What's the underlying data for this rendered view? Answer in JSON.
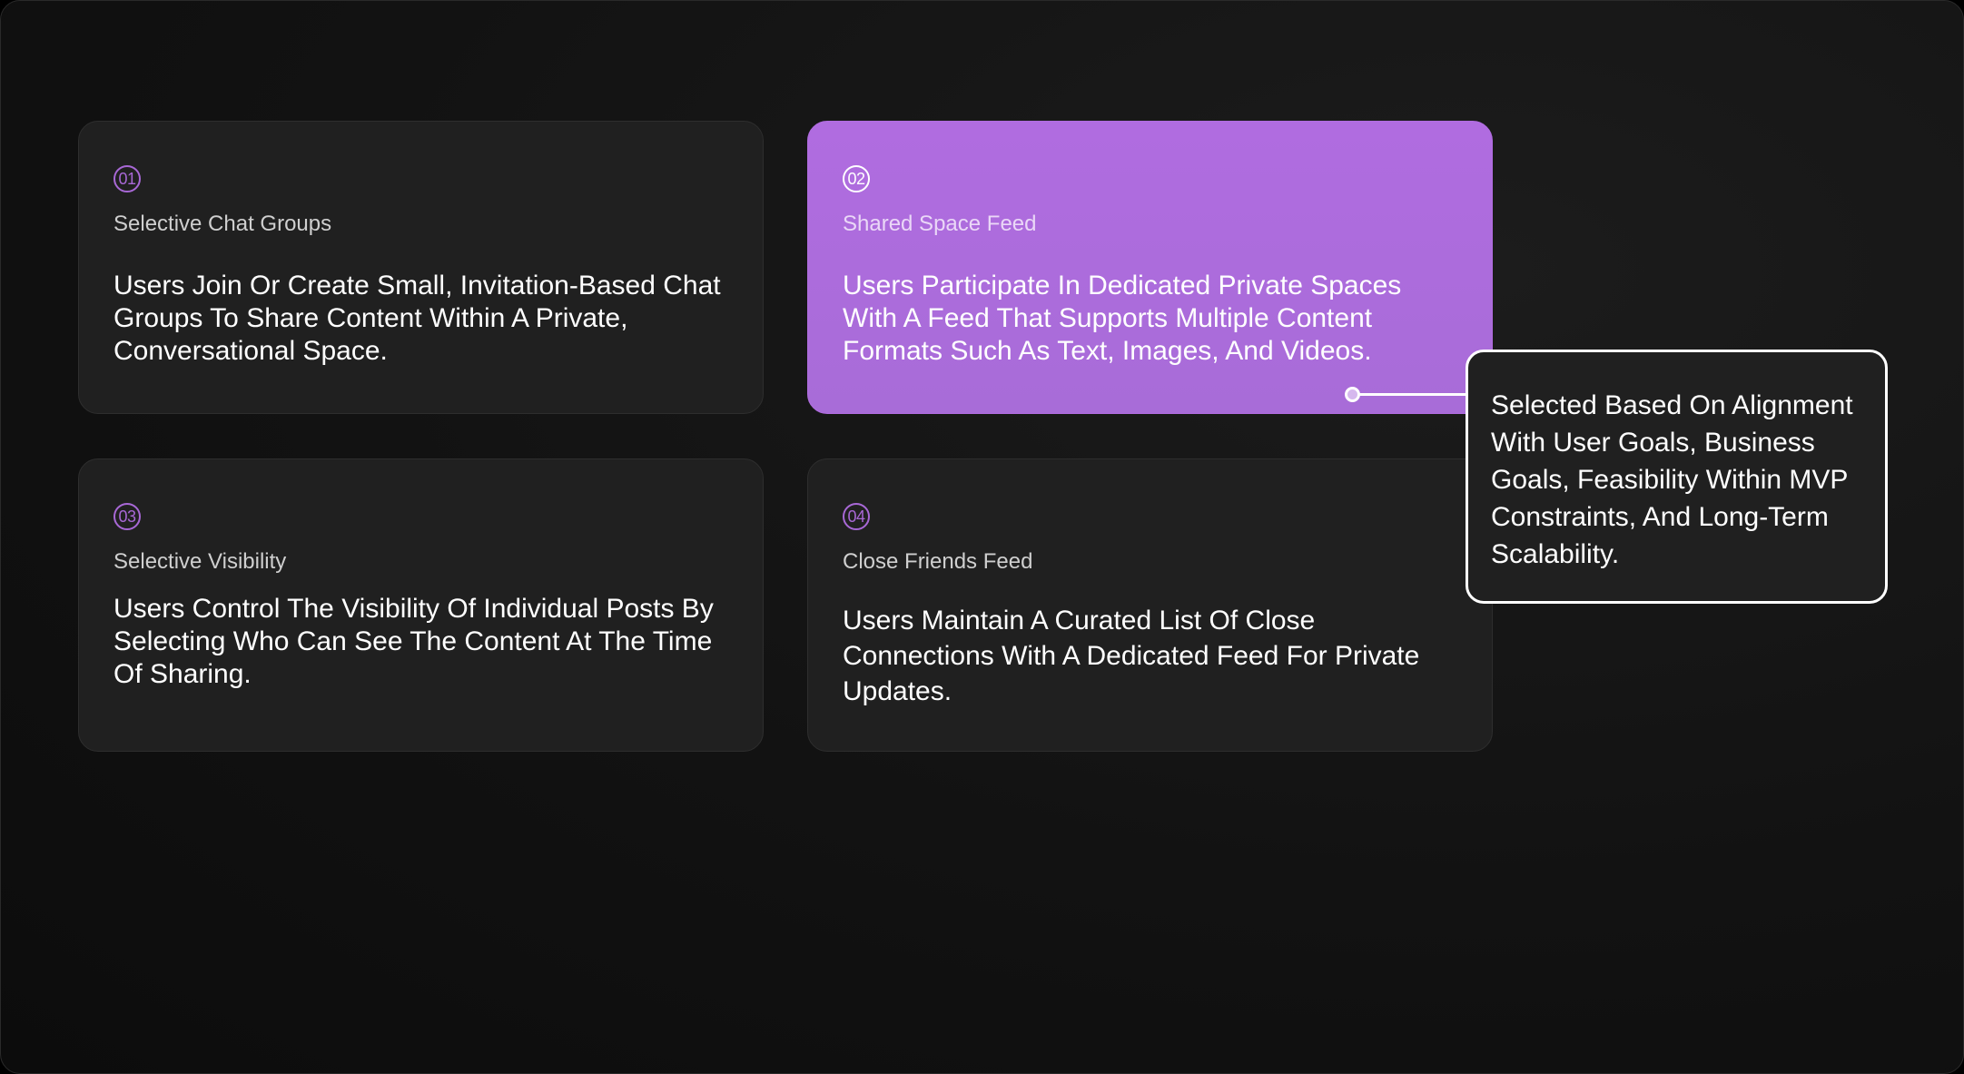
{
  "cards": [
    {
      "number": "01",
      "title": "Selective Chat Groups",
      "description": "Users Join Or Create Small, Invitation-Based Chat Groups To Share Content Within A Private, Conversational Space."
    },
    {
      "number": "02",
      "title": "Shared Space Feed",
      "description": "Users Participate In Dedicated Private Spaces With A Feed That Supports Multiple Content Formats Such As Text, Images, And Videos."
    },
    {
      "number": "03",
      "title": "Selective Visibility",
      "description": "Users Control The Visibility Of Individual Posts By Selecting Who Can See The Content At The Time Of Sharing."
    },
    {
      "number": "04",
      "title": "Close Friends Feed",
      "description": "Users Maintain A Curated List Of Close Connections With A Dedicated Feed For Private Updates."
    }
  ],
  "callout": {
    "text": "Selected Based On Alignment With User Goals, Business Goals, Feasibility Within MVP Constraints, And Long-Term Scalability."
  },
  "colors": {
    "accent": "#a868d6",
    "highlight_card": "#ad6cdc",
    "card_bg": "#202020",
    "page_bg": "#121212"
  }
}
